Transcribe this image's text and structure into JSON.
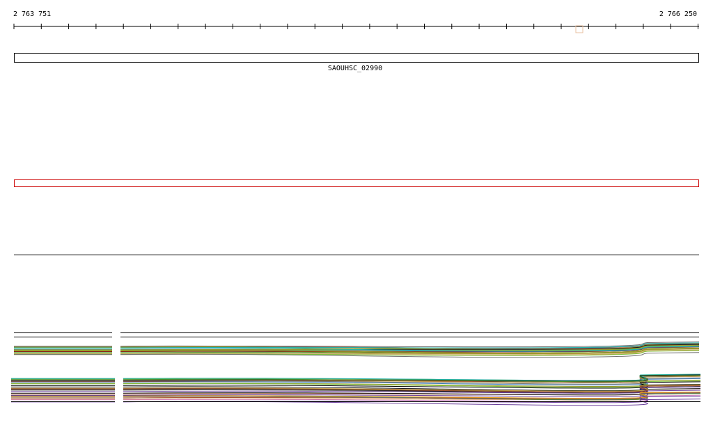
{
  "ruler": {
    "start_label": "2 763 751",
    "end_label": "2 766 250"
  },
  "gene": {
    "label": "SAOUHSC_02990",
    "color": "#000000"
  },
  "selection": {
    "color": "#cc0000"
  },
  "colors": {
    "line_palette": [
      "#000000",
      "#1a1a1a",
      "#8b1a1a",
      "#c86432",
      "#d2691e",
      "#7cbf3a",
      "#4a8f2a",
      "#9a9a2a",
      "#c8a050",
      "#d080c0",
      "#b05090",
      "#6a3d9a",
      "#3a7fc0",
      "#20b2aa",
      "#e8a020",
      "#a0522d",
      "#707070",
      "#555555"
    ]
  }
}
